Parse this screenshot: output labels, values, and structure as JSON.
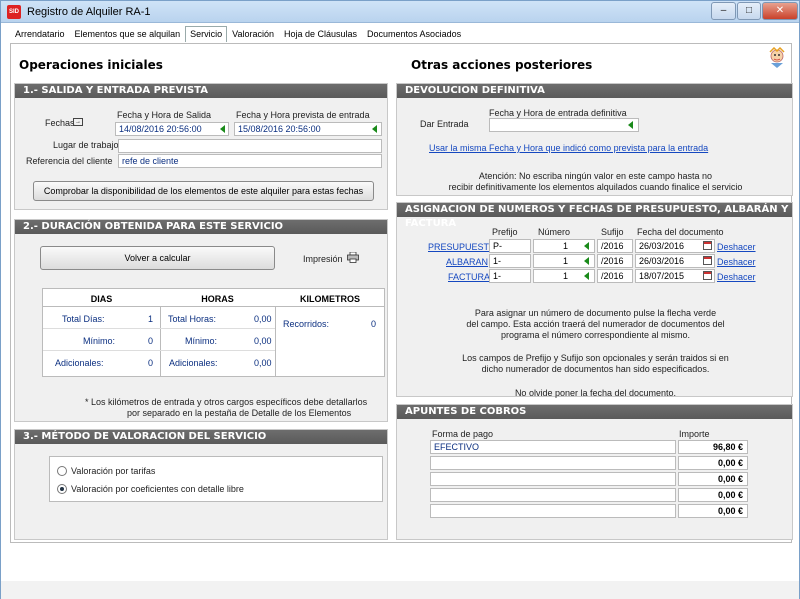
{
  "window": {
    "title": "Registro de Alquiler RA-1",
    "icon_text": "SID"
  },
  "tabs": [
    "Arrendatario",
    "Elementos que se alquilan",
    "Servicio",
    "Valoración",
    "Hoja de Cláusulas",
    "Documentos Asociados"
  ],
  "active_tab": "Servicio",
  "left_title": "Operaciones iniciales",
  "right_title": "Otras acciones posteriores",
  "salida": {
    "header": "1.- SALIDA Y ENTRADA PREVISTA",
    "fechas_label": "Fechas",
    "col1": "Fecha y Hora de Salida",
    "col2": "Fecha y Hora prevista de entrada",
    "salida_value": "14/08/2016 20:56:00",
    "entrada_value": "15/08/2016 20:56:00",
    "lugar_label": "Lugar de trabajo",
    "lugar_value": "",
    "referencia_label": "Referencia del cliente",
    "referencia_value": "refe de cliente",
    "check_button": "Comprobar la disponibilidad de los elementos de este alquiler para estas fechas"
  },
  "duracion": {
    "header": "2.- DURACIÓN OBTENIDA PARA ESTE SERVICIO",
    "recalc_button": "Volver a calcular",
    "impresion_label": "Impresión",
    "dias_header": "DIAS",
    "horas_header": "HORAS",
    "km_header": "KILOMETROS",
    "total_dias_label": "Total Días:",
    "total_dias": "1",
    "minimo_label": "Mínimo:",
    "minimo_dias": "0",
    "adicionales_label": "Adicionales:",
    "adicionales_dias": "0",
    "total_horas_label": "Total Horas:",
    "total_horas": "0,00",
    "minimo_horas": "0,00",
    "adicionales_horas": "0,00",
    "recorridos_label": "Recorridos:",
    "recorridos": "0",
    "note1": "* Los kilómetros de entrada y otros cargos específicos debe detallarlos",
    "note2": "por separado en la pestaña de Detalle de los Elementos"
  },
  "metodo": {
    "header": "3.- MÉTODO DE VALORACION DEL SERVICIO",
    "option1": "Valoración por tarifas",
    "option2": "Valoración por coeficientes con detalle libre",
    "selected": "Valoración por coeficientes con detalle libre"
  },
  "devolucion": {
    "header": "DEVOLUCION DEFINITIVA",
    "col": "Fecha y Hora de entrada definitiva",
    "dar_entrada": "Dar Entrada",
    "entrada_value": "",
    "link": "Usar la misma Fecha y Hora que indicó como prevista para la entrada",
    "warn1": "Atención: No escriba ningún valor en este campo hasta no",
    "warn2": "recibir definitivamente los elementos alquilados cuando finalice el servicio"
  },
  "asignacion": {
    "header": "ASIGNACION DE NUMEROS Y FECHAS DE PRESUPUESTO, ALBARÁN Y FACTURA",
    "cols": [
      "Prefijo",
      "Número",
      "Sufijo",
      "Fecha del documento"
    ],
    "rows": [
      {
        "label": "PRESUPUESTO",
        "prefijo": "P-",
        "numero": "1",
        "sufijo": "/2016",
        "fecha": "26/03/2016",
        "action": "Deshacer"
      },
      {
        "label": "ALBARAN",
        "prefijo": "1-",
        "numero": "1",
        "sufijo": "/2016",
        "fecha": "26/03/2016",
        "action": "Deshacer"
      },
      {
        "label": "FACTURA",
        "prefijo": "1-",
        "numero": "1",
        "sufijo": "/2016",
        "fecha": "18/07/2015",
        "action": "Deshacer"
      }
    ],
    "info1": "Para asignar un número de documento pulse la flecha verde",
    "info2": "del campo. Esta acción traerá del numerador de documentos del",
    "info3": "programa el número correspondiente al mismo.",
    "info4": "Los campos de Prefijo y Sufijo son opcionales y serán traidos si en",
    "info5": "dicho numerador de documentos han sido especificados.",
    "info6": "No olvide poner la fecha del documento."
  },
  "cobros": {
    "header": "APUNTES DE COBROS",
    "col_forma": "Forma de pago",
    "col_importe": "Importe",
    "rows": [
      {
        "forma": "EFECTIVO",
        "importe": "96,80 €"
      },
      {
        "forma": "",
        "importe": "0,00 €"
      },
      {
        "forma": "",
        "importe": "0,00 €"
      },
      {
        "forma": "",
        "importe": "0,00 €"
      },
      {
        "forma": "",
        "importe": "0,00 €"
      }
    ]
  }
}
